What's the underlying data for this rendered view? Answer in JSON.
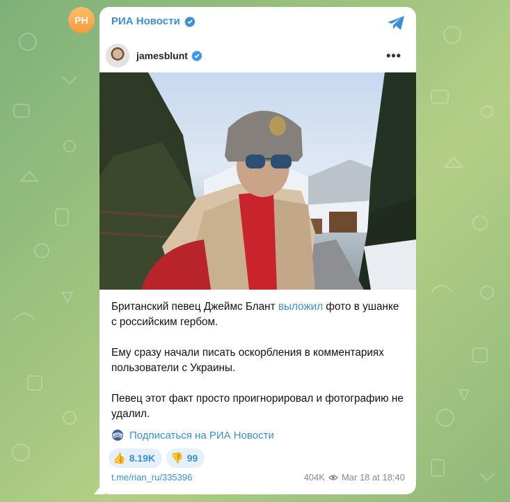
{
  "channel": {
    "avatar_initials": "PH",
    "name": "РИА Новости"
  },
  "embed": {
    "username": "jamesblunt",
    "more_icon": "more-horizontal-icon"
  },
  "post": {
    "paragraph1_before": "Британский певец Джеймс Блант ",
    "paragraph1_link": "выложил",
    "paragraph1_after": " фото в ушанке с российским гербом.",
    "paragraph2": "Ему сразу начали писать оскорбления в комментариях пользователи с Украины.",
    "paragraph3": "Певец этот факт просто проигнорировал и фотографию не удалил."
  },
  "subscribe": {
    "label": "Подписаться на РИА Новости"
  },
  "reactions": [
    {
      "emoji": "👍",
      "count": "8.19K"
    },
    {
      "emoji": "👎",
      "count": "99"
    }
  ],
  "footer": {
    "link": "t.me/rian_ru/335396",
    "views": "404K",
    "date": "Mar 18 at 18:40"
  },
  "colors": {
    "accent": "#3a8fd6",
    "avatar": "#f59a3c"
  }
}
